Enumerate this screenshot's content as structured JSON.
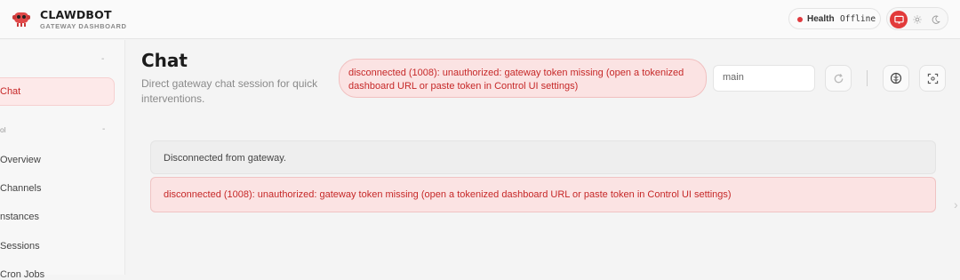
{
  "app": {
    "name": "CLAWDBOT",
    "subtitle": "GATEWAY DASHBOARD"
  },
  "health": {
    "label": "Health",
    "value": "Offline",
    "status_color": "#e0393e"
  },
  "theme_switch": {
    "options": [
      "monitor-icon",
      "sun-icon",
      "moon-icon"
    ],
    "selected": "monitor-icon",
    "accent": "#e23a3a"
  },
  "sidebar": {
    "collapse_glyph": "-",
    "active_item": "Chat",
    "group_label": "ol",
    "group_toggle": "-",
    "items": [
      "Overview",
      "Channels",
      "nstances",
      "Sessions",
      "Cron Jobs"
    ]
  },
  "page": {
    "title": "Chat",
    "subtitle": "Direct gateway chat session for quick interventions."
  },
  "error_banner": "disconnected (1008): unauthorized: gateway token missing (open a tokenized dashboard URL or paste token in Control UI settings)",
  "session_input": {
    "value": "main"
  },
  "chat": {
    "notice": "Disconnected from gateway.",
    "error": "disconnected (1008): unauthorized: gateway token missing (open a tokenized dashboard URL or paste token in Control UI settings)"
  }
}
